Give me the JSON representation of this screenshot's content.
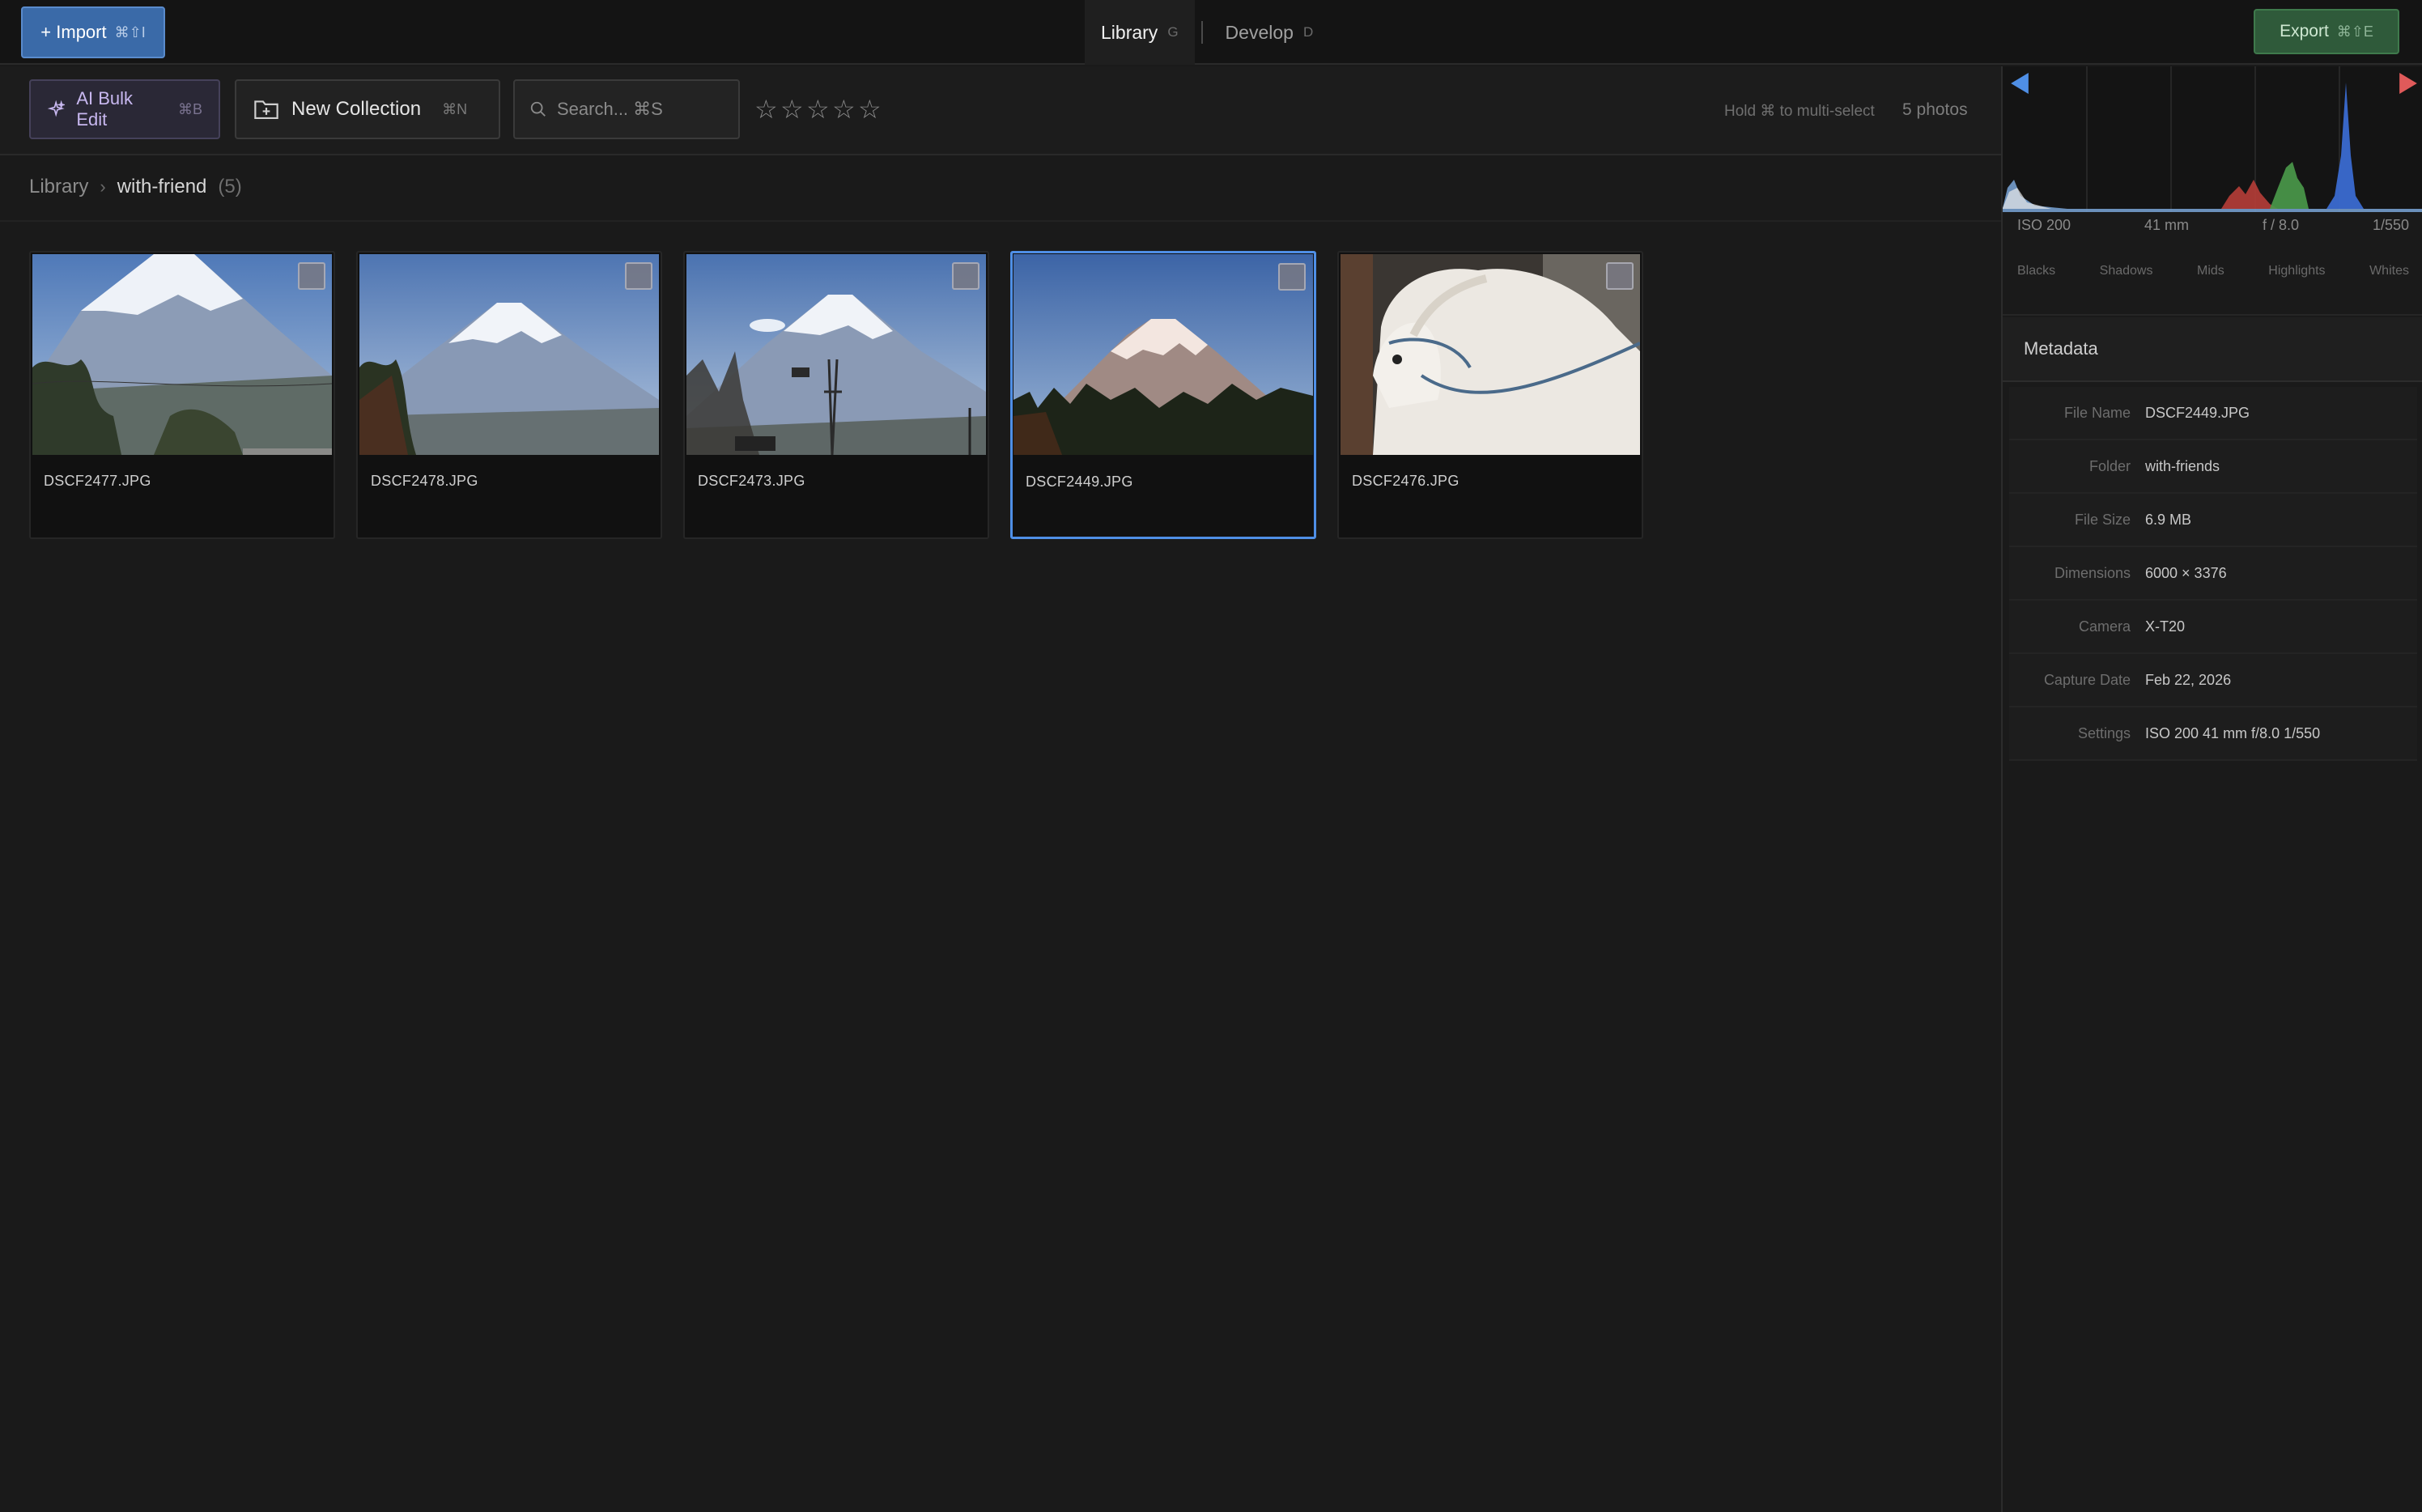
{
  "topbar": {
    "import_label": "+ Import",
    "import_shortcut": "⌘⇧I",
    "tabs": [
      {
        "label": "Library",
        "shortcut": "G"
      },
      {
        "label": "Develop",
        "shortcut": "D"
      }
    ],
    "export_label": "Export",
    "export_shortcut": "⌘⇧E"
  },
  "toolbar": {
    "ai_label": "AI Bulk Edit",
    "ai_shortcut": "⌘B",
    "collection_label": "New Collection",
    "collection_shortcut": "⌘N",
    "search_placeholder": "Search... ⌘S",
    "stars": [
      "☆",
      "☆",
      "☆",
      "☆",
      "☆"
    ],
    "hint": "Hold ⌘ to multi-select",
    "count": "5 photos"
  },
  "breadcrumb": {
    "root": "Library",
    "separator": "›",
    "current": "with-friend",
    "count": "(5)"
  },
  "photos": [
    {
      "name": "DSCF2477.JPG",
      "selected": false
    },
    {
      "name": "DSCF2478.JPG",
      "selected": false
    },
    {
      "name": "DSCF2473.JPG",
      "selected": false
    },
    {
      "name": "DSCF2449.JPG",
      "selected": true
    },
    {
      "name": "DSCF2476.JPG",
      "selected": false
    }
  ],
  "histogram": {
    "exif": [
      "ISO 200",
      "41 mm",
      "f / 8.0",
      "1/550"
    ],
    "zones": [
      "Blacks",
      "Shadows",
      "Mids",
      "Highlights",
      "Whites"
    ]
  },
  "metadata": {
    "title": "Metadata",
    "rows": [
      {
        "label": "File Name",
        "value": "DSCF2449.JPG"
      },
      {
        "label": "Folder",
        "value": "with-friends"
      },
      {
        "label": "File Size",
        "value": "6.9 MB"
      },
      {
        "label": "Dimensions",
        "value": "6000 × 3376"
      },
      {
        "label": "Camera",
        "value": "X-T20"
      },
      {
        "label": "Capture Date",
        "value": "Feb 22, 2026"
      },
      {
        "label": "Settings",
        "value": "ISO 200 41 mm f/8.0 1/550"
      }
    ]
  },
  "colors": {
    "accent": "#4f8fe6",
    "import_bg": "#3a6aa8",
    "export_bg": "#2f5a3a",
    "ai_text": "#c8b8f0"
  }
}
